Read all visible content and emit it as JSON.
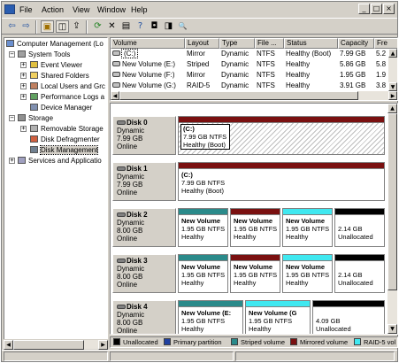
{
  "menu": {
    "items": [
      {
        "label": "File"
      },
      {
        "label": "Action"
      },
      {
        "label": "View"
      },
      {
        "label": "Window"
      },
      {
        "label": "Help"
      }
    ],
    "window_buttons": [
      "_",
      "□",
      "×"
    ]
  },
  "toolbar": {
    "back": "⇦",
    "forward": "⇨",
    "up": "▣",
    "show_tree": "◫",
    "export": "⇪",
    "help": "?",
    "refresh": "⟳",
    "delete": "✕",
    "properties": "▤",
    "save": "◘",
    "open": "◨",
    "search": "🔍"
  },
  "tree": {
    "items": [
      {
        "label": "Computer Management (Lo",
        "icon": "computer-icon"
      },
      {
        "label": "System Tools",
        "icon": "tools-icon"
      },
      {
        "label": "Event Viewer",
        "icon": "event-viewer-icon"
      },
      {
        "label": "Shared Folders",
        "icon": "shared-folder-icon"
      },
      {
        "label": "Local Users and Grc",
        "icon": "users-icon"
      },
      {
        "label": "Performance Logs a",
        "icon": "performance-icon"
      },
      {
        "label": "Device Manager",
        "icon": "device-manager-icon"
      },
      {
        "label": "Storage",
        "icon": "storage-icon"
      },
      {
        "label": "Removable Storage",
        "icon": "removable-storage-icon"
      },
      {
        "label": "Disk Defragmenter",
        "icon": "defrag-icon"
      },
      {
        "label": "Disk Management",
        "icon": "disk-management-icon"
      },
      {
        "label": "Services and Applicatio",
        "icon": "services-icon"
      }
    ]
  },
  "volume_list": {
    "columns": [
      "Volume",
      "Layout",
      "Type",
      "File ...",
      "Status",
      "Capacity",
      "Fre"
    ],
    "rows": [
      {
        "volume": "(C:)",
        "layout": "Mirror",
        "type": "Dynamic",
        "fs": "NTFS",
        "status": "Healthy (Boot)",
        "capacity": "7.99 GB",
        "free": "5.2"
      },
      {
        "volume": "New Volume (E:)",
        "layout": "Striped",
        "type": "Dynamic",
        "fs": "NTFS",
        "status": "Healthy",
        "capacity": "5.86 GB",
        "free": "5.8"
      },
      {
        "volume": "New Volume (F:)",
        "layout": "Mirror",
        "type": "Dynamic",
        "fs": "NTFS",
        "status": "Healthy",
        "capacity": "1.95 GB",
        "free": "1.9"
      },
      {
        "volume": "New Volume (G:)",
        "layout": "RAID-5",
        "type": "Dynamic",
        "fs": "NTFS",
        "status": "Healthy",
        "capacity": "3.91 GB",
        "free": "3.8"
      }
    ]
  },
  "disks": [
    {
      "name": "Disk 0",
      "type": "Dynamic",
      "size": "7.99 GB",
      "status": "Online",
      "volumes": [
        {
          "name": "(C:)",
          "size": "7.99 GB NTFS",
          "status": "Healthy (Boot)",
          "kind": "mirrored"
        }
      ]
    },
    {
      "name": "Disk 1",
      "type": "Dynamic",
      "size": "7.99 GB",
      "status": "Online",
      "volumes": [
        {
          "name": "(C:)",
          "size": "7.99 GB NTFS",
          "status": "Healthy (Boot)",
          "kind": "mirrored"
        }
      ]
    },
    {
      "name": "Disk 2",
      "type": "Dynamic",
      "size": "8.00 GB",
      "status": "Online",
      "volumes": [
        {
          "name": "New Volume",
          "size": "1.95 GB NTFS",
          "status": "Healthy",
          "kind": "striped"
        },
        {
          "name": "New Volume",
          "size": "1.95 GB NTFS",
          "status": "Healthy",
          "kind": "mirrored"
        },
        {
          "name": "New Volume",
          "size": "1.95 GB NTFS",
          "status": "Healthy",
          "kind": "raid5"
        },
        {
          "name": "",
          "size": "2.14 GB",
          "status": "Unallocated",
          "kind": "unallocated"
        }
      ]
    },
    {
      "name": "Disk 3",
      "type": "Dynamic",
      "size": "8.00 GB",
      "status": "Online",
      "volumes": [
        {
          "name": "New Volume",
          "size": "1.95 GB NTFS",
          "status": "Healthy",
          "kind": "striped"
        },
        {
          "name": "New Volume",
          "size": "1.95 GB NTFS",
          "status": "Healthy",
          "kind": "mirrored"
        },
        {
          "name": "New Volume",
          "size": "1.95 GB NTFS",
          "status": "Healthy",
          "kind": "raid5"
        },
        {
          "name": "",
          "size": "2.14 GB",
          "status": "Unallocated",
          "kind": "unallocated"
        }
      ]
    },
    {
      "name": "Disk 4",
      "type": "Dynamic",
      "size": "8.00 GB",
      "status": "Online",
      "volumes": [
        {
          "name": "New Volume  (E:",
          "size": "1.95 GB NTFS",
          "status": "Healthy",
          "kind": "striped"
        },
        {
          "name": "New Volume  (G",
          "size": "1.95 GB NTFS",
          "status": "Healthy",
          "kind": "raid5"
        },
        {
          "name": "",
          "size": "4.09 GB",
          "status": "Unallocated",
          "kind": "unallocated"
        }
      ]
    }
  ],
  "legend": [
    {
      "label": "Unallocated",
      "color": "#000000"
    },
    {
      "label": "Primary partition",
      "color": "#2040a0"
    },
    {
      "label": "Striped volume",
      "color": "#2a8a8a"
    },
    {
      "label": "Mirrored volume",
      "color": "#7a1010"
    },
    {
      "label": "RAID-5 vol",
      "color": "#40e8f0"
    }
  ],
  "colors": {
    "unallocated": "#000000",
    "primary": "#2040a0",
    "striped": "#2a8a8a",
    "mirrored": "#7a1010",
    "raid5": "#40e8f0"
  }
}
